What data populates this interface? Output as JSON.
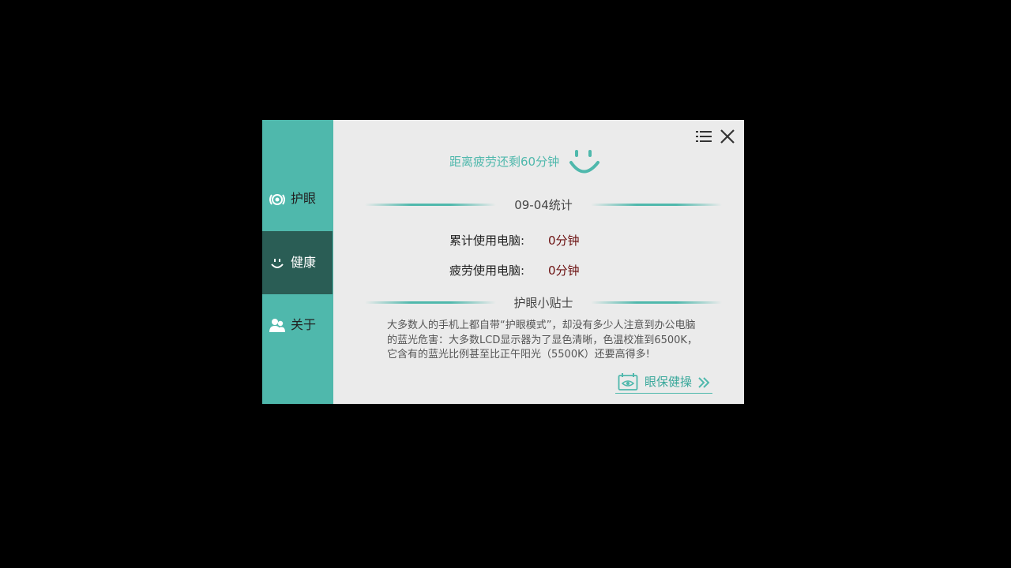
{
  "colors": {
    "accent": "#4fb8ac",
    "sidebar_active": "#2a5d55",
    "panel_bg": "#ebebeb",
    "value_text": "#6b1010"
  },
  "sidebar": {
    "items": [
      {
        "label": "护眼",
        "icon": "eye-protect-icon",
        "active": false
      },
      {
        "label": "健康",
        "icon": "smile-icon",
        "active": true
      },
      {
        "label": "关于",
        "icon": "users-icon",
        "active": false
      }
    ]
  },
  "header": {
    "menu_icon": "menu-list-icon",
    "close_icon": "close-icon",
    "countdown_text": "距离疲劳还剩60分钟",
    "mood_icon": "smiley-icon"
  },
  "stats": {
    "title": "09-04统计",
    "rows": [
      {
        "label": "累计使用电脑:",
        "value": "0分钟"
      },
      {
        "label": "疲劳使用电脑:",
        "value": "0分钟"
      }
    ]
  },
  "tips": {
    "title": "护眼小贴士",
    "text": "大多数人的手机上都自带“护眼模式”，却没有多少人注意到办公电脑的蓝光危害：大多数LCD显示器为了显色清晰，色温校准到6500K，它含有的蓝光比例甚至比正午阳光（5500K）还要高得多!"
  },
  "exercise_link": {
    "label": "眼保健操",
    "icon": "eye-exercise-icon",
    "arrow_icon": "double-chevron-right-icon"
  }
}
